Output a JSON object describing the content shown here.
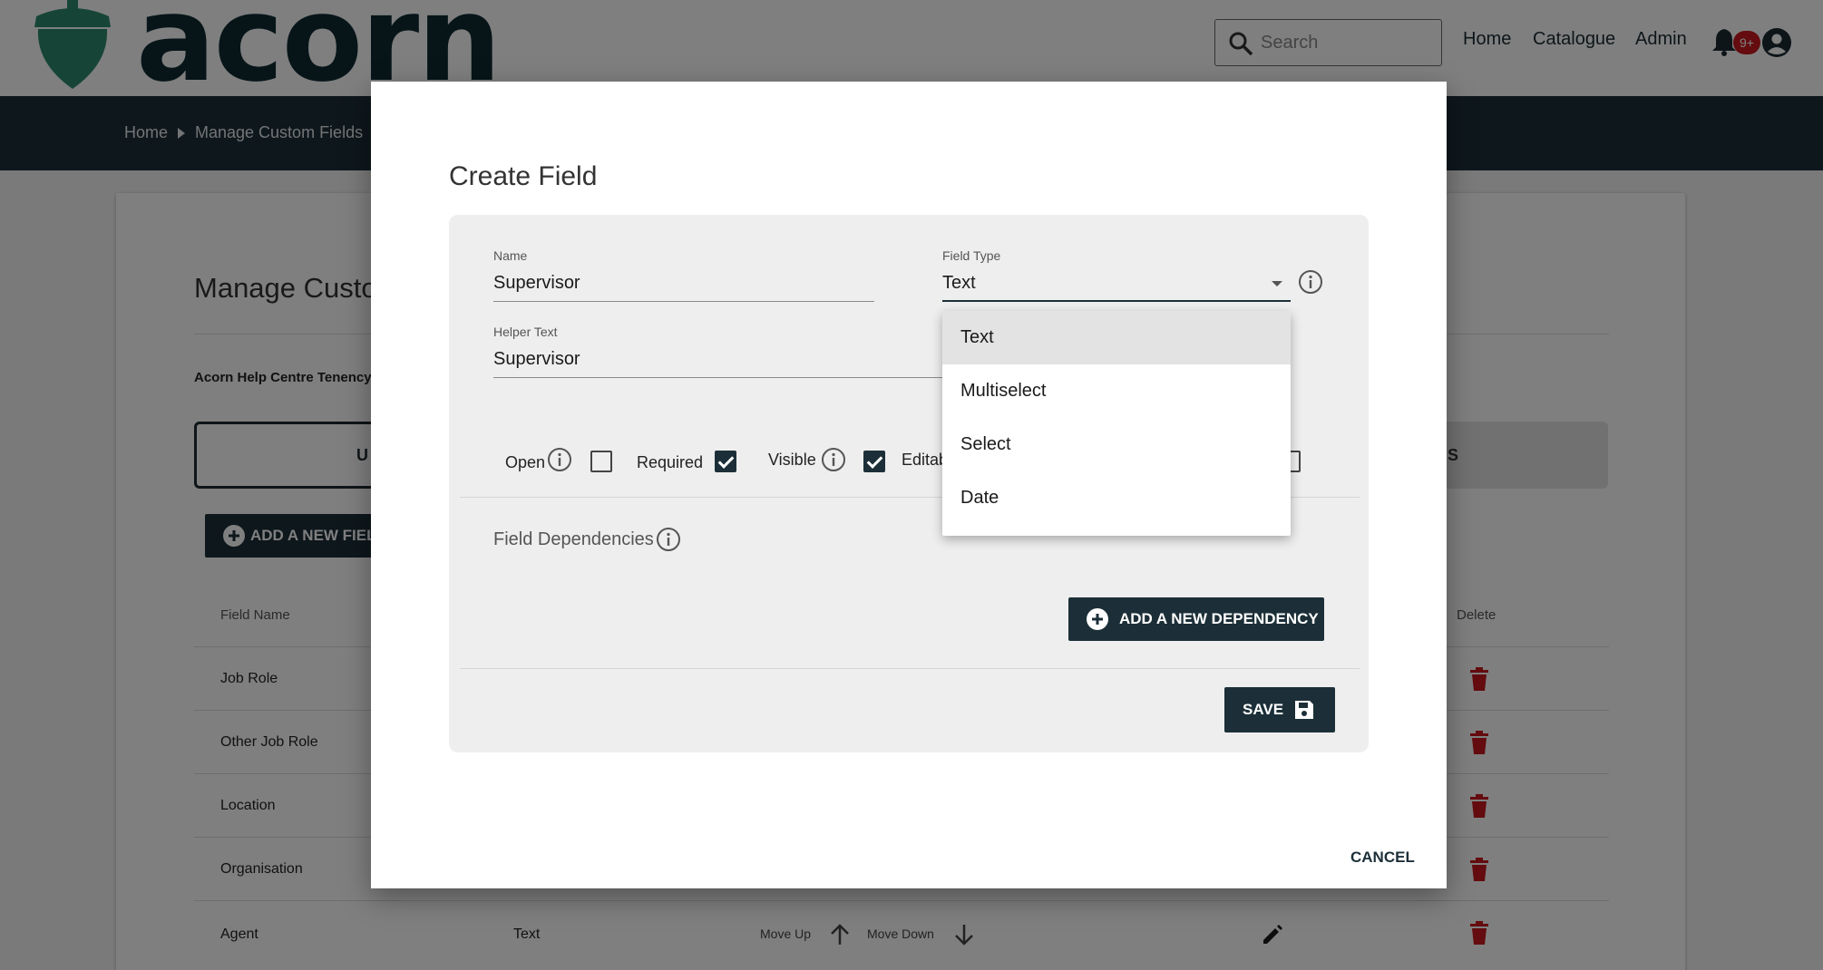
{
  "brand": {
    "name": "acorn",
    "logo_color": "#2d8a6e",
    "text_color": "#0f2a33"
  },
  "header": {
    "search_placeholder": "Search",
    "nav": [
      "Home",
      "Catalogue",
      "Admin"
    ],
    "notification_badge": "9+"
  },
  "breadcrumb": [
    "Home",
    "Manage Custom Fields"
  ],
  "background_page": {
    "title": "Manage Custor",
    "tenancy": "Acorn Help Centre Tenency",
    "tab_left_label": "U",
    "tab_right_label": "S",
    "add_field_label": "ADD A NEW FIEL",
    "columns": {
      "field_name": "Field Name",
      "delete": "Delete"
    },
    "rows": [
      {
        "name": "Job Role"
      },
      {
        "name": "Other Job Role"
      },
      {
        "name": "Location"
      },
      {
        "name": "Organisation"
      },
      {
        "name": "Agent",
        "type": "Text",
        "move_up": "Move Up",
        "move_down": "Move Down"
      }
    ]
  },
  "modal": {
    "title": "Create Field",
    "name_label": "Name",
    "name_value": "Supervisor",
    "field_type_label": "Field Type",
    "field_type_value": "Text",
    "helper_label": "Helper Text",
    "helper_value": "Supervisor",
    "checkboxes": [
      {
        "label": "Open",
        "checked": false
      },
      {
        "label": "Required",
        "checked": true
      },
      {
        "label": "Visible",
        "checked": true
      },
      {
        "label": "Editab",
        "checked": false
      }
    ],
    "dependencies_label": "Field Dependencies",
    "add_dependency_label": "ADD A NEW DEPENDENCY",
    "save_label": "SAVE",
    "cancel_label": "CANCEL"
  },
  "field_type_menu": {
    "options": [
      "Text",
      "Multiselect",
      "Select",
      "Date"
    ],
    "selected": "Text"
  },
  "colors": {
    "primary": "#1c2f38",
    "danger": "#c8191f",
    "overlay": "rgba(0,0,0,0.5)"
  }
}
